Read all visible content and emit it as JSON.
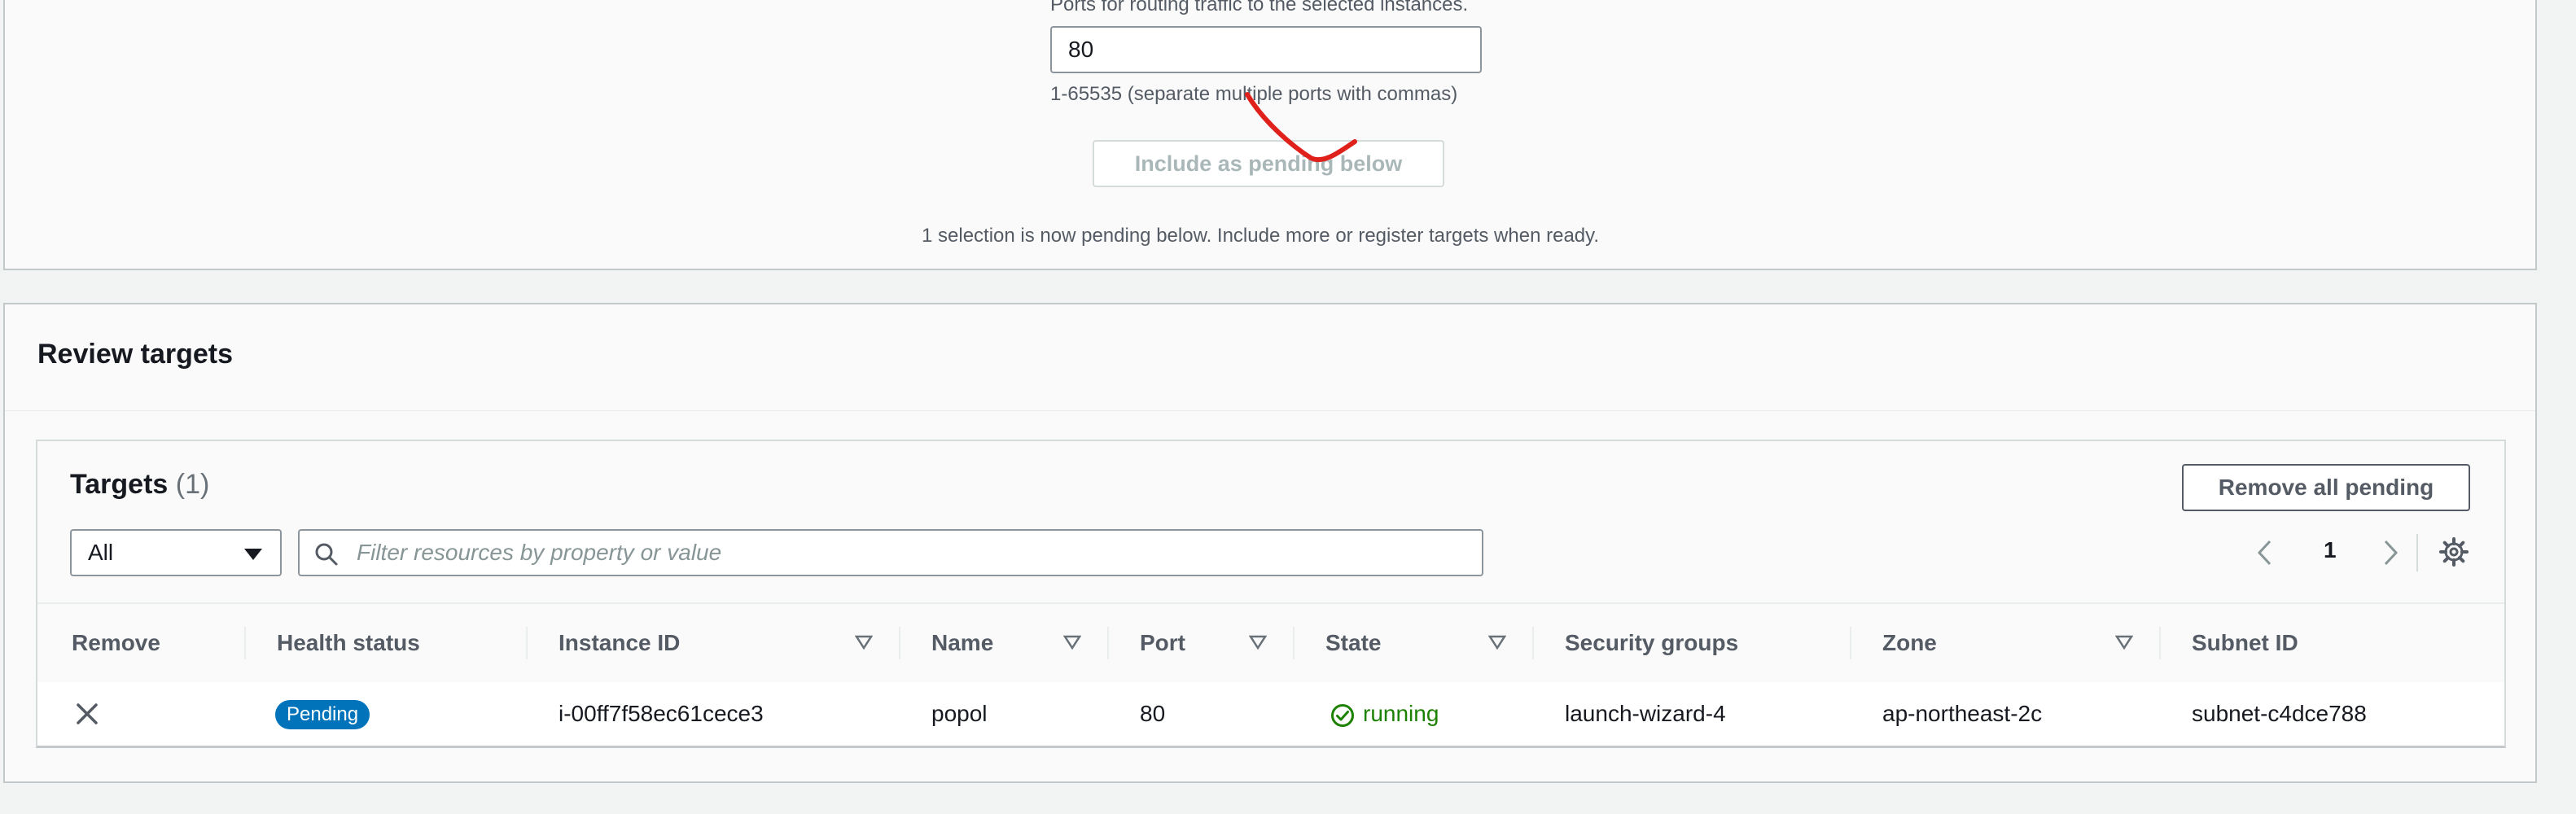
{
  "ports": {
    "caption": "Ports for routing traffic to the selected instances.",
    "value": "80",
    "hint": "1-65535 (separate multiple ports with commas)"
  },
  "include_button": "Include as pending below",
  "selection_message": "1 selection is now pending below. Include more or register targets when ready.",
  "review": {
    "title": "Review targets",
    "targets": {
      "title": "Targets",
      "count": "(1)",
      "remove_all_label": "Remove all pending",
      "filter_value": "All",
      "search_placeholder": "Filter resources by property or value",
      "page": "1",
      "columns": [
        "Remove",
        "Health status",
        "Instance ID",
        "Name",
        "Port",
        "State",
        "Security groups",
        "Zone",
        "Subnet ID"
      ],
      "rows": [
        {
          "health": "Pending",
          "instance_id": "i-00ff7f58ec61cece3",
          "name": "popol",
          "port": "80",
          "state": "running",
          "security_groups": "launch-wizard-4",
          "zone": "ap-northeast-2c",
          "subnet_id": "subnet-c4dce788"
        }
      ]
    }
  },
  "colors": {
    "accent_blue": "#0073bb",
    "running_green": "#1d8102",
    "annotation_red": "#e0201b"
  }
}
